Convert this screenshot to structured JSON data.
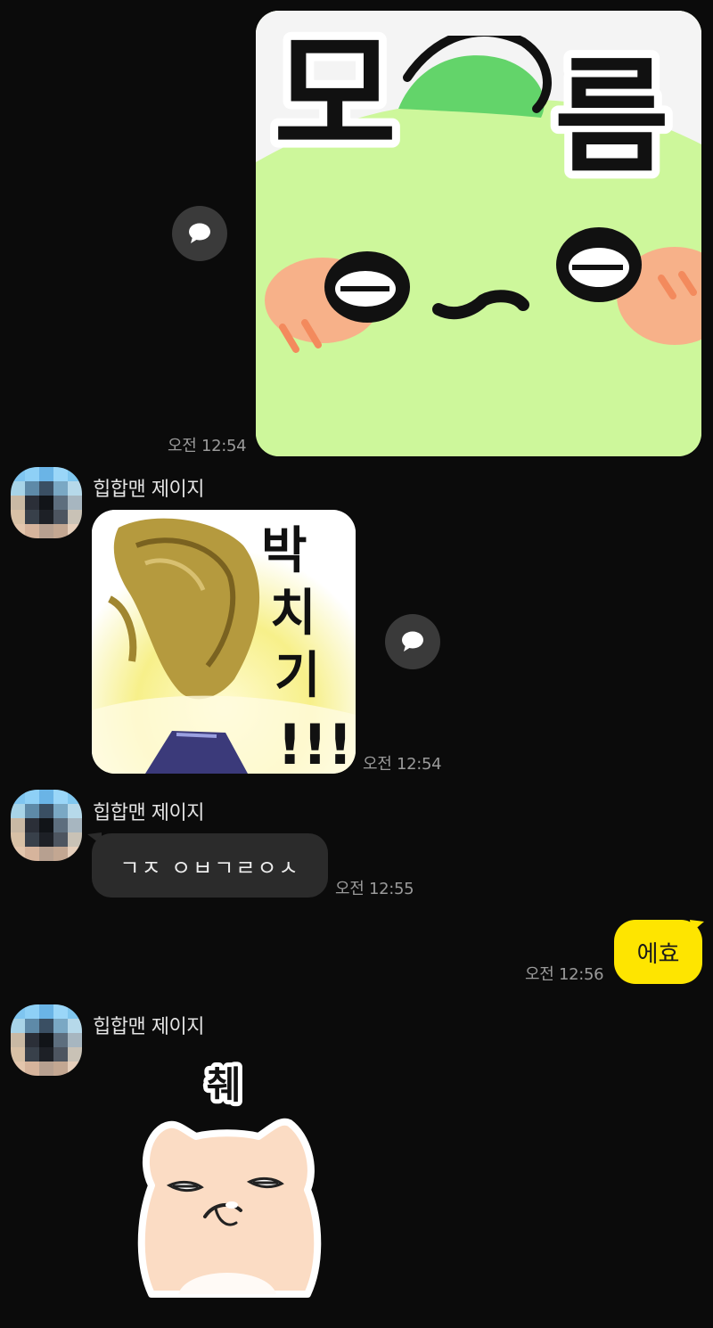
{
  "messages": [
    {
      "type": "sticker",
      "direction": "outgoing",
      "sticker_text": "모~름",
      "time": "오전 12:54"
    },
    {
      "type": "sticker",
      "direction": "incoming",
      "sender": "힙합맨 제이지",
      "sticker_text": "박치기!!!",
      "time": "오전 12:54"
    },
    {
      "type": "text",
      "direction": "incoming",
      "sender": "힙합맨 제이지",
      "text": "ㄱㅈ ㅇㅂㄱㄹㅇㅅ",
      "time": "오전 12:55"
    },
    {
      "type": "text",
      "direction": "outgoing",
      "text": "에효",
      "time": "오전 12:56"
    },
    {
      "type": "sticker",
      "direction": "incoming",
      "sender": "힙합맨 제이지",
      "sticker_text": "췌"
    }
  ],
  "colors": {
    "background": "#0b0b0b",
    "incoming_bubble": "#2b2b2b",
    "outgoing_bubble": "#fee500",
    "reply_button": "#3a3a3a"
  },
  "icons": {
    "reply": "speech-bubble-icon"
  }
}
